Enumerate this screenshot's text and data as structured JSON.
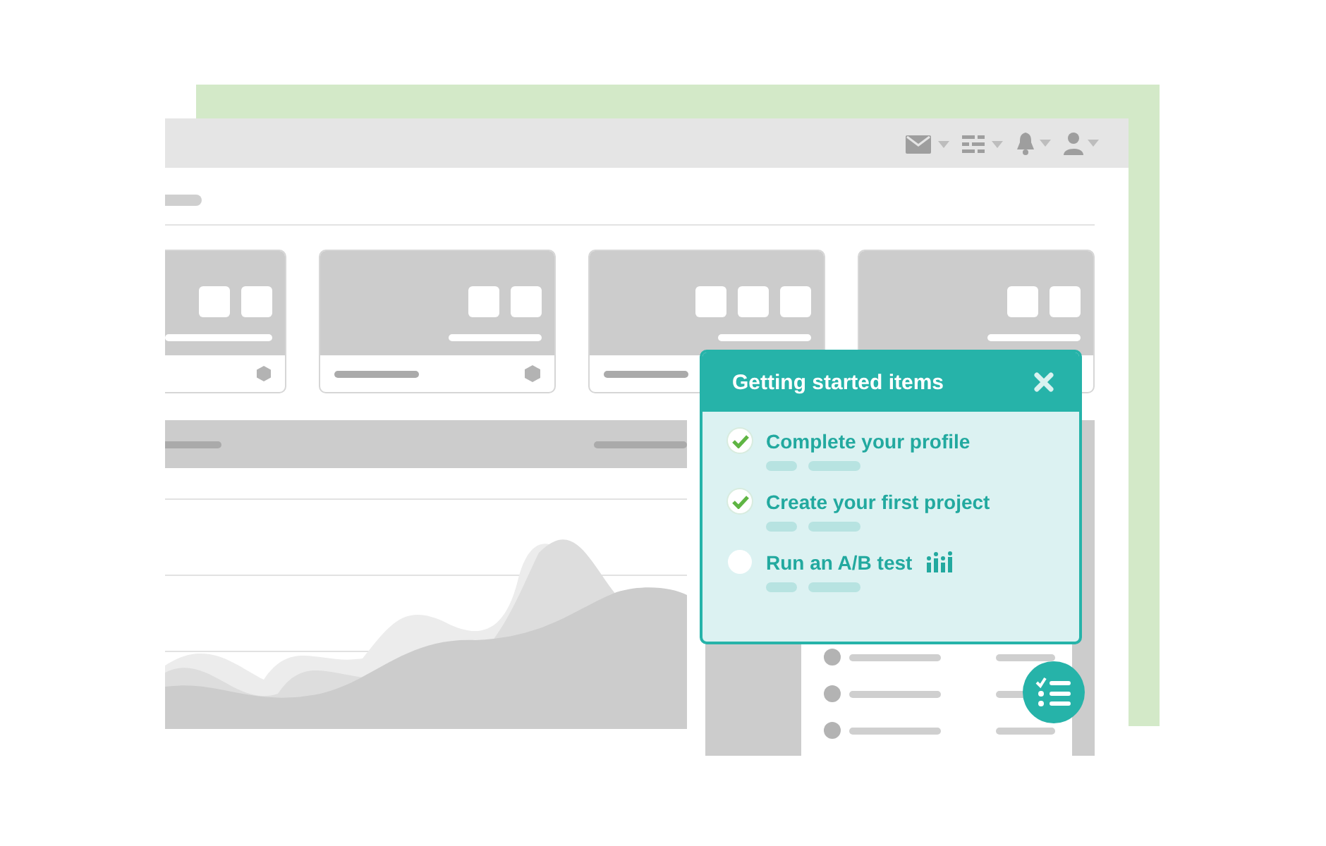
{
  "popup": {
    "title": "Getting started items",
    "items": [
      {
        "label": "Complete your profile",
        "checked": true,
        "kind": "plain"
      },
      {
        "label": "Create your first project",
        "checked": true,
        "kind": "plain"
      },
      {
        "label": "Run an A/B test",
        "checked": false,
        "kind": "chart"
      }
    ]
  }
}
